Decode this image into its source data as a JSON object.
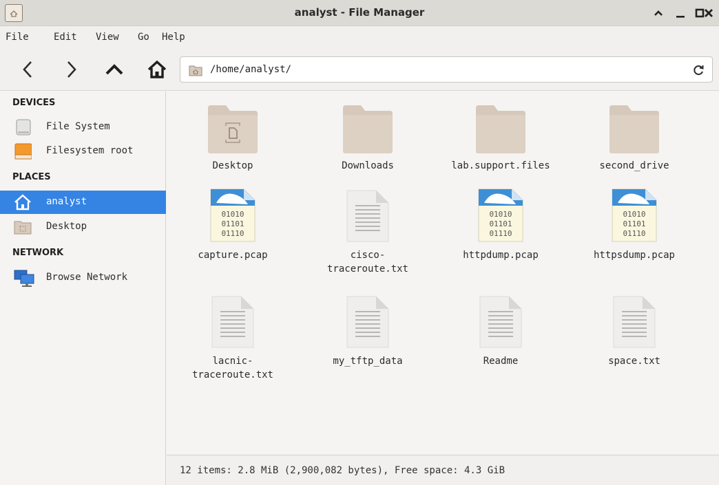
{
  "window": {
    "title": "analyst - File Manager",
    "app_icon": "home-folder-icon"
  },
  "menu": [
    "File",
    "Edit",
    "View",
    "Go",
    "Help"
  ],
  "toolbar": {
    "back_icon": "chevron-left-icon",
    "forward_icon": "chevron-right-icon",
    "up_icon": "chevron-up-icon",
    "home_icon": "home-icon",
    "location": "/home/analyst/",
    "reload_icon": "reload-icon"
  },
  "sidebar": {
    "devices_header": "DEVICES",
    "devices": [
      {
        "label": "File System",
        "icon": "drive-icon"
      },
      {
        "label": "Filesystem root",
        "icon": "root-drive-icon"
      }
    ],
    "places_header": "PLACES",
    "places": [
      {
        "label": "analyst",
        "icon": "home-icon",
        "selected": true
      },
      {
        "label": "Desktop",
        "icon": "desktop-folder-icon"
      }
    ],
    "network_header": "NETWORK",
    "network": [
      {
        "label": "Browse Network",
        "icon": "network-icon"
      }
    ]
  },
  "files": [
    {
      "name": "Desktop",
      "type": "desktop-folder"
    },
    {
      "name": "Downloads",
      "type": "folder"
    },
    {
      "name": "lab.support.files",
      "type": "folder"
    },
    {
      "name": "second_drive",
      "type": "folder"
    },
    {
      "name": "capture.pcap",
      "type": "binary"
    },
    {
      "name": "cisco-traceroute.txt",
      "type": "text",
      "line1": "cisco-",
      "line2": "traceroute.txt"
    },
    {
      "name": "httpdump.pcap",
      "type": "binary"
    },
    {
      "name": "httpsdump.pcap",
      "type": "binary"
    },
    {
      "name": "lacnic-traceroute.txt",
      "type": "text",
      "line1": "lacnic-",
      "line2": "traceroute.txt"
    },
    {
      "name": "my_tftp_data",
      "type": "text"
    },
    {
      "name": "Readme",
      "type": "text"
    },
    {
      "name": "space.txt",
      "type": "text"
    }
  ],
  "binary_icon_text": "01010\n01101\n01110",
  "status": "12 items: 2.8 MiB (2,900,082 bytes), Free space: 4.3 GiB",
  "colors": {
    "selection": "#3584e4",
    "folder": "#d8cbbd",
    "binary_accent": "#3e8fd6"
  }
}
